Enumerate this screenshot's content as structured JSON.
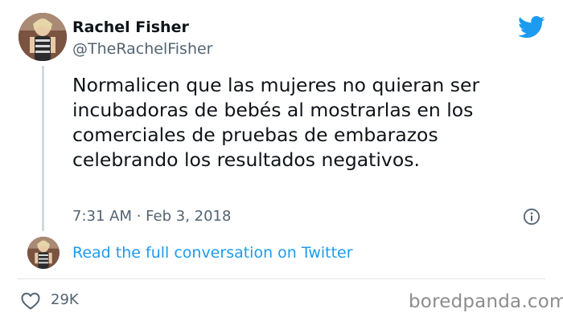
{
  "author": {
    "display_name": "Rachel Fisher",
    "handle": "@TheRachelFisher"
  },
  "tweet": {
    "text": "Normalicen que las mujeres no quieran ser incubadoras de bebés al mostrarlas en los comerciales de pruebas de embarazos celebrando los resultados negativos.",
    "timestamp": "7:31 AM · Feb 3, 2018"
  },
  "thread": {
    "link_text": "Read the full conversation on Twitter"
  },
  "engagement": {
    "likes": "29K"
  },
  "watermark": "boredpanda.com",
  "icons": {
    "brand": "twitter-bird-icon",
    "info": "info-icon",
    "like": "heart-icon"
  },
  "colors": {
    "link": "#1d9bf0",
    "brand": "#1d9bf0",
    "secondary_text": "#536471",
    "primary_text": "#0f1419"
  }
}
